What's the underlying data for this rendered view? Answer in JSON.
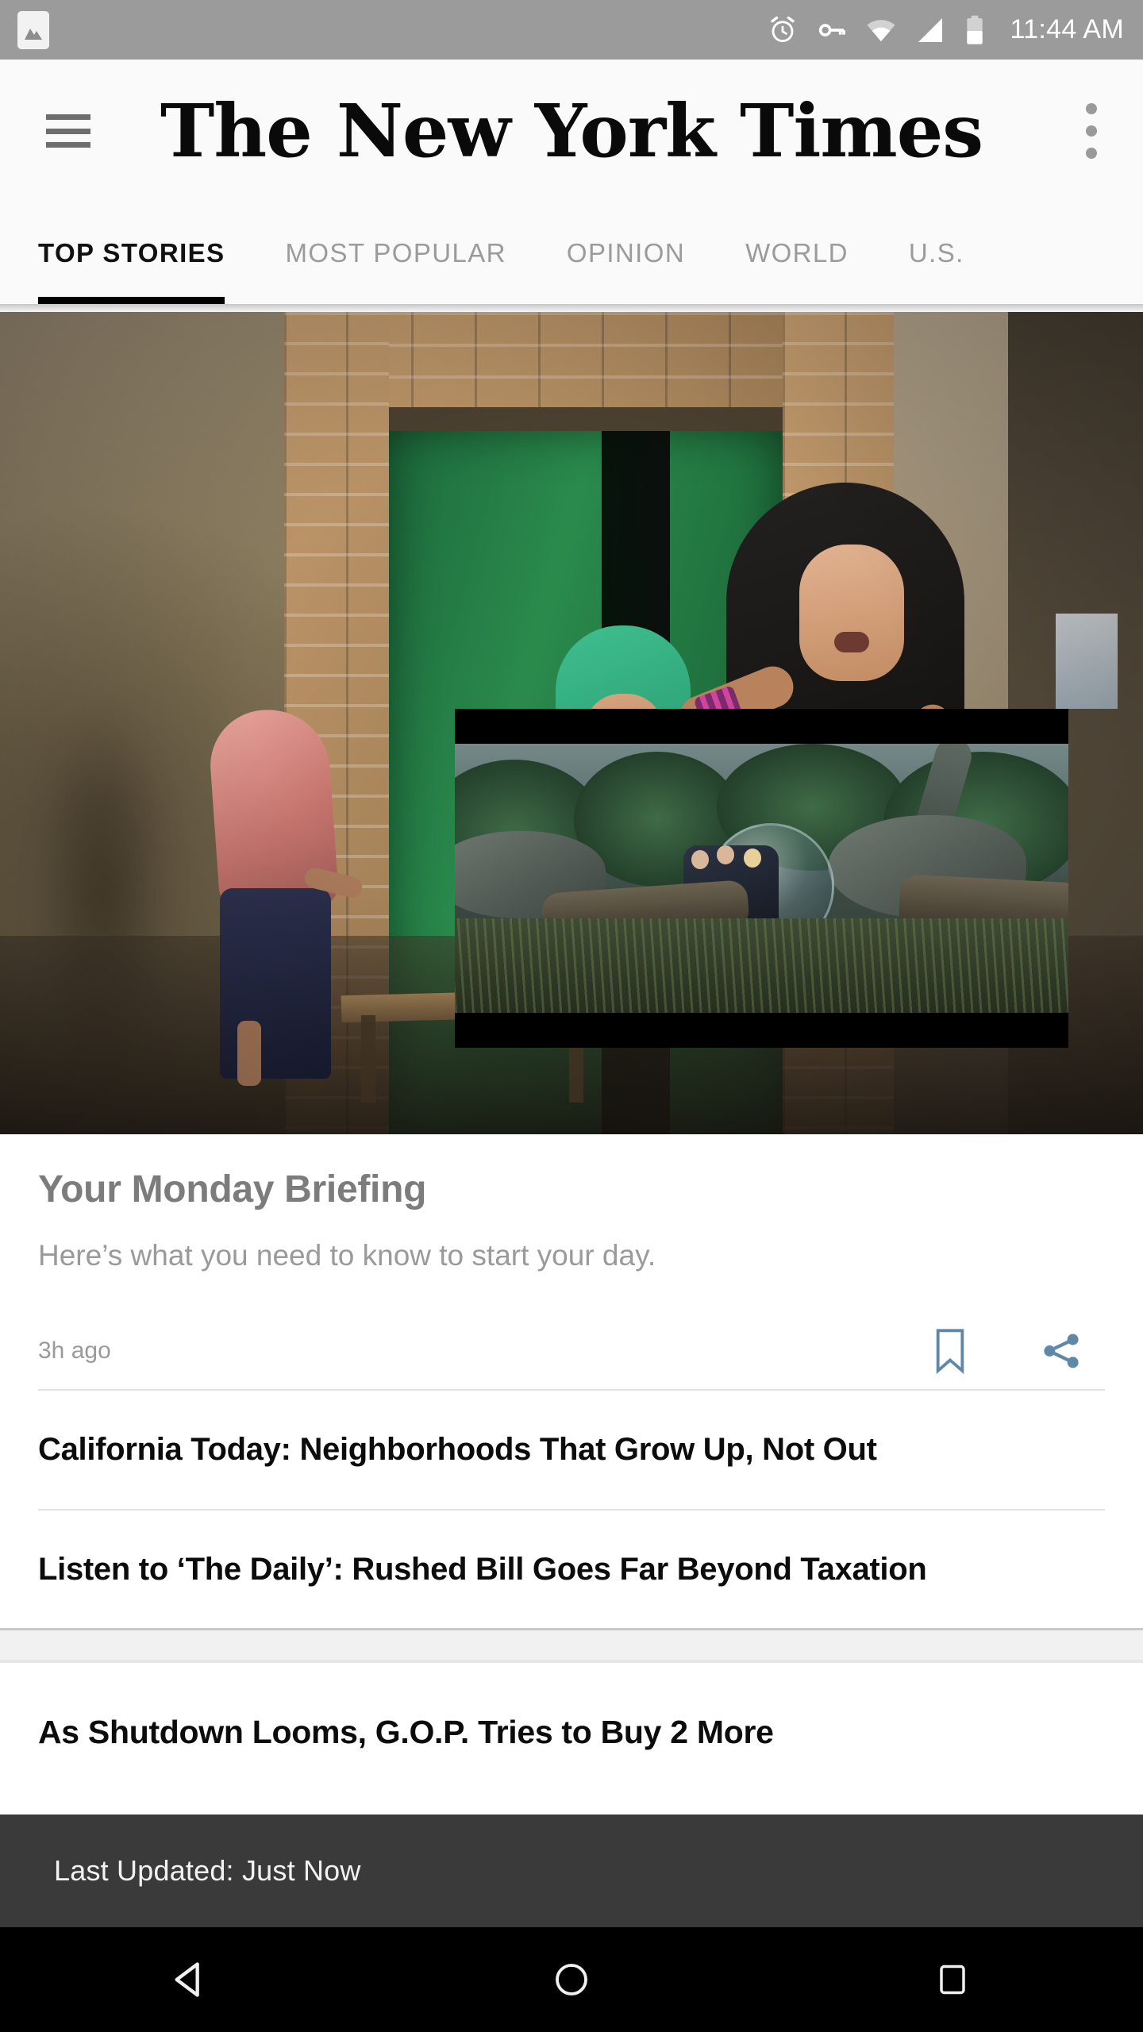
{
  "status_bar": {
    "app_icon": "image-icon",
    "icons": [
      "alarm-icon",
      "vpn-key-icon",
      "wifi-icon",
      "cellular-signal-icon",
      "battery-icon"
    ],
    "time": "11:44 AM",
    "background_color": "#9b9b9b"
  },
  "app_bar": {
    "menu_icon": "hamburger-menu-icon",
    "title": "The New York Times",
    "overflow_icon": "more-vertical-icon",
    "background_color": "#fafafa"
  },
  "tabs": {
    "active_index": 0,
    "indicator_color": "#000000",
    "items": [
      {
        "label": "TOP STORIES"
      },
      {
        "label": "MOST POPULAR"
      },
      {
        "label": "OPINION"
      },
      {
        "label": "WORLD"
      },
      {
        "label": "U.S."
      }
    ]
  },
  "hero": {
    "alt": "Woman in black veil and orange dress outside a building with a green door",
    "pip_alt": "Picture-in-picture video of dinosaurs and a gyrosphere in a jungle"
  },
  "lede": {
    "title": "Your Monday Briefing",
    "summary": "Here’s what you need to know to start your day.",
    "timestamp": "3h ago",
    "bookmark_icon": "bookmark-icon",
    "share_icon": "share-icon",
    "action_color": "#5f87a8"
  },
  "articles": [
    {
      "headline": "California Today: Neighborhoods That Grow Up, Not Out"
    },
    {
      "headline": "Listen to ‘The Daily’: Rushed Bill Goes Far Beyond Taxation"
    },
    {
      "headline": "As Shutdown Looms, G.O.P. Tries to Buy 2 More"
    }
  ],
  "toast": {
    "message": "Last Updated: Just Now",
    "background_color": "#3a3a3a"
  },
  "nav_bar": {
    "back_icon": "back-triangle-icon",
    "home_icon": "home-circle-icon",
    "recents_icon": "recents-square-icon",
    "background_color": "#000000"
  }
}
